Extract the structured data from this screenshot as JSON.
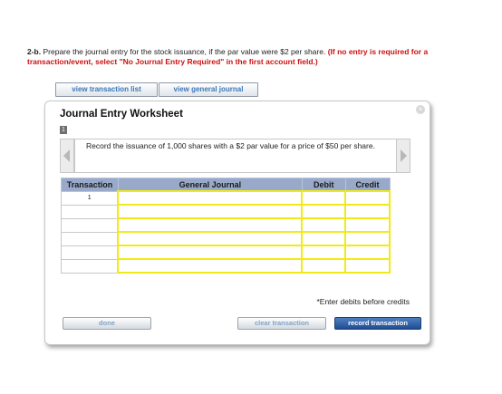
{
  "instructions": {
    "number": "2-b.",
    "text": " Prepare the journal entry for the stock issuance, if the par value were $2 per share. ",
    "note": "(If no entry is required for a transaction/event, select \"No Journal Entry Required\" in the first account field.)"
  },
  "top_buttons": {
    "view_transaction_list": "view transaction list",
    "view_general_journal": "view general journal"
  },
  "worksheet": {
    "title": "Journal Entry Worksheet",
    "page_number": "1",
    "close_glyph": "×",
    "prompt": "Record the issuance of 1,000 shares with a $2 par value for a price of $50 per share.",
    "columns": {
      "transaction": "Transaction",
      "general_journal": "General Journal",
      "debit": "Debit",
      "credit": "Credit"
    },
    "rows": [
      {
        "transaction": "1"
      },
      {
        "transaction": ""
      },
      {
        "transaction": ""
      },
      {
        "transaction": ""
      },
      {
        "transaction": ""
      },
      {
        "transaction": ""
      }
    ],
    "note": "*Enter debits before credits",
    "buttons": {
      "done": "done",
      "clear": "clear transaction",
      "record": "record transaction"
    }
  },
  "colors": {
    "header": "#98a9c9",
    "input_border": "#f2ea18",
    "warning": "#cc1111",
    "primary_button": "#2a5aa0"
  }
}
